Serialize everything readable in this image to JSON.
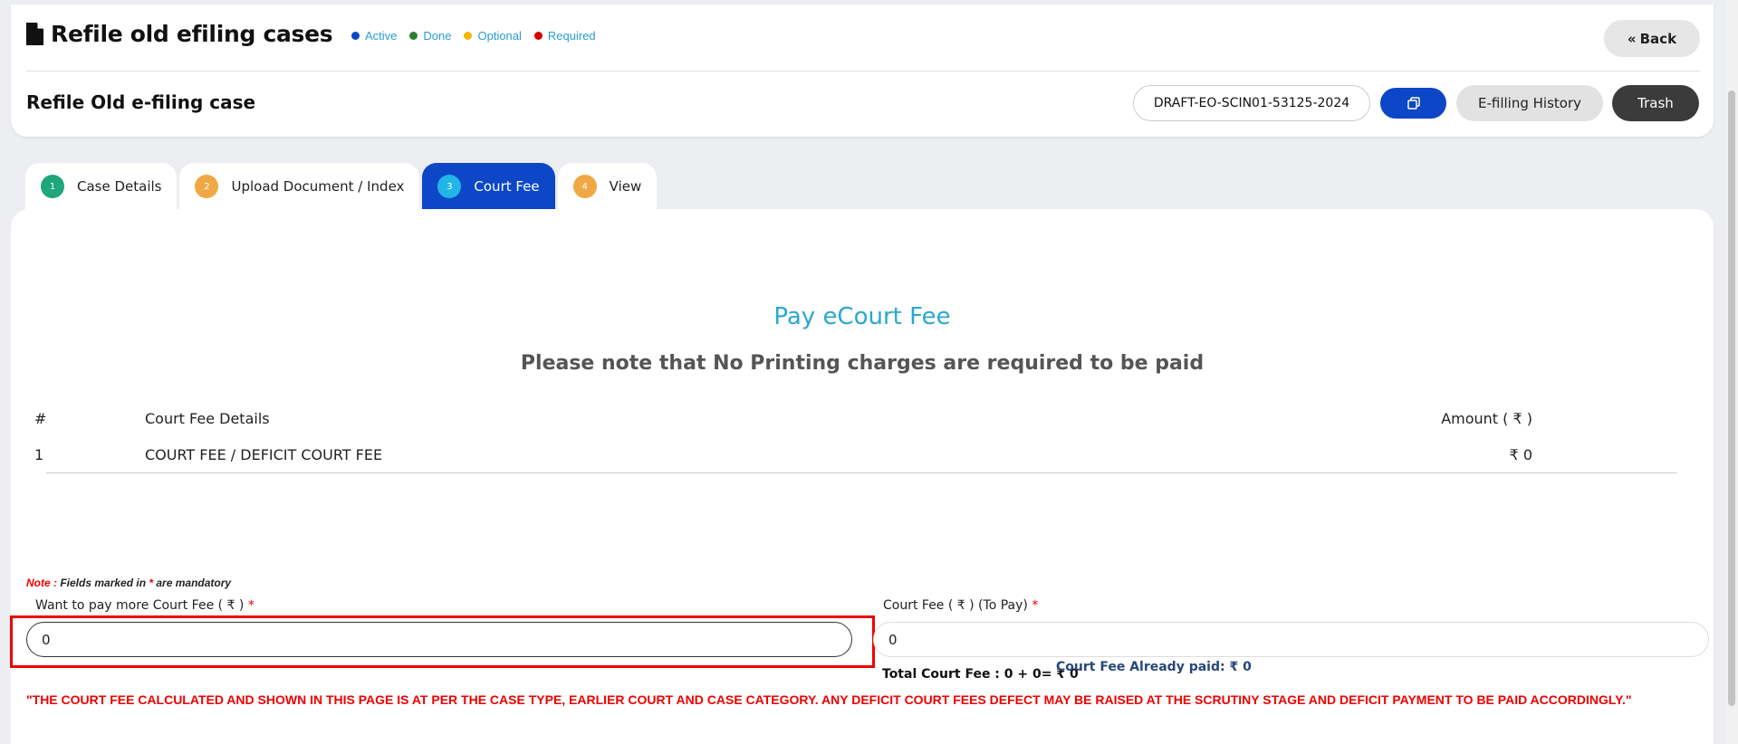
{
  "header": {
    "title": "Refile old efiling cases",
    "legend": [
      {
        "label": "Active",
        "color": "#0d47c7"
      },
      {
        "label": "Done",
        "color": "#2e7d32"
      },
      {
        "label": "Optional",
        "color": "#f2b705"
      },
      {
        "label": "Required",
        "color": "#d50000"
      }
    ],
    "back_label": "Back",
    "sub_title": "Refile Old e-filing case",
    "draft_id": "DRAFT-EO-SCIN01-53125-2024",
    "history_label": "E-filling History",
    "trash_label": "Trash"
  },
  "tabs": [
    {
      "num": "1",
      "label": "Case Details",
      "color": "#1fa67a",
      "active": false
    },
    {
      "num": "2",
      "label": "Upload Document / Index",
      "color": "#f0a845",
      "active": false
    },
    {
      "num": "3",
      "label": "Court Fee",
      "color": "#22b5e8",
      "active": true
    },
    {
      "num": "4",
      "label": "View",
      "color": "#f0a845",
      "active": false
    }
  ],
  "main": {
    "pay_title": "Pay eCourt Fee",
    "print_note": "Please note that No Printing charges are required to be paid",
    "table": {
      "headers": [
        "#",
        "Court Fee Details",
        "Amount ( ₹ )"
      ],
      "rows": [
        [
          "1",
          "COURT FEE / DEFICIT COURT FEE",
          "₹ 0"
        ]
      ]
    },
    "note_prefix": "Note :",
    "note_text_1": " Fields marked in ",
    "note_star": "*",
    "note_text_2": " are mandatory",
    "more_fee_label": "Want to pay more Court Fee ( ₹ )",
    "more_fee_value": "0",
    "to_pay_label": "Court Fee ( ₹ ) (To Pay)",
    "to_pay_value": "0",
    "total_fee": "Total Court Fee : 0 + 0= ₹ 0",
    "already_paid": "Court Fee Already paid: ₹ 0",
    "warning": "\"THE COURT FEE CALCULATED AND SHOWN IN THIS PAGE IS AT PER THE CASE TYPE, EARLIER COURT AND CASE CATEGORY. ANY DEFICIT COURT FEES DEFECT MAY BE RAISED AT THE SCRUTINY STAGE AND DEFICIT PAYMENT TO BE PAID ACCORDINGLY.\"",
    "required_star": "*"
  }
}
